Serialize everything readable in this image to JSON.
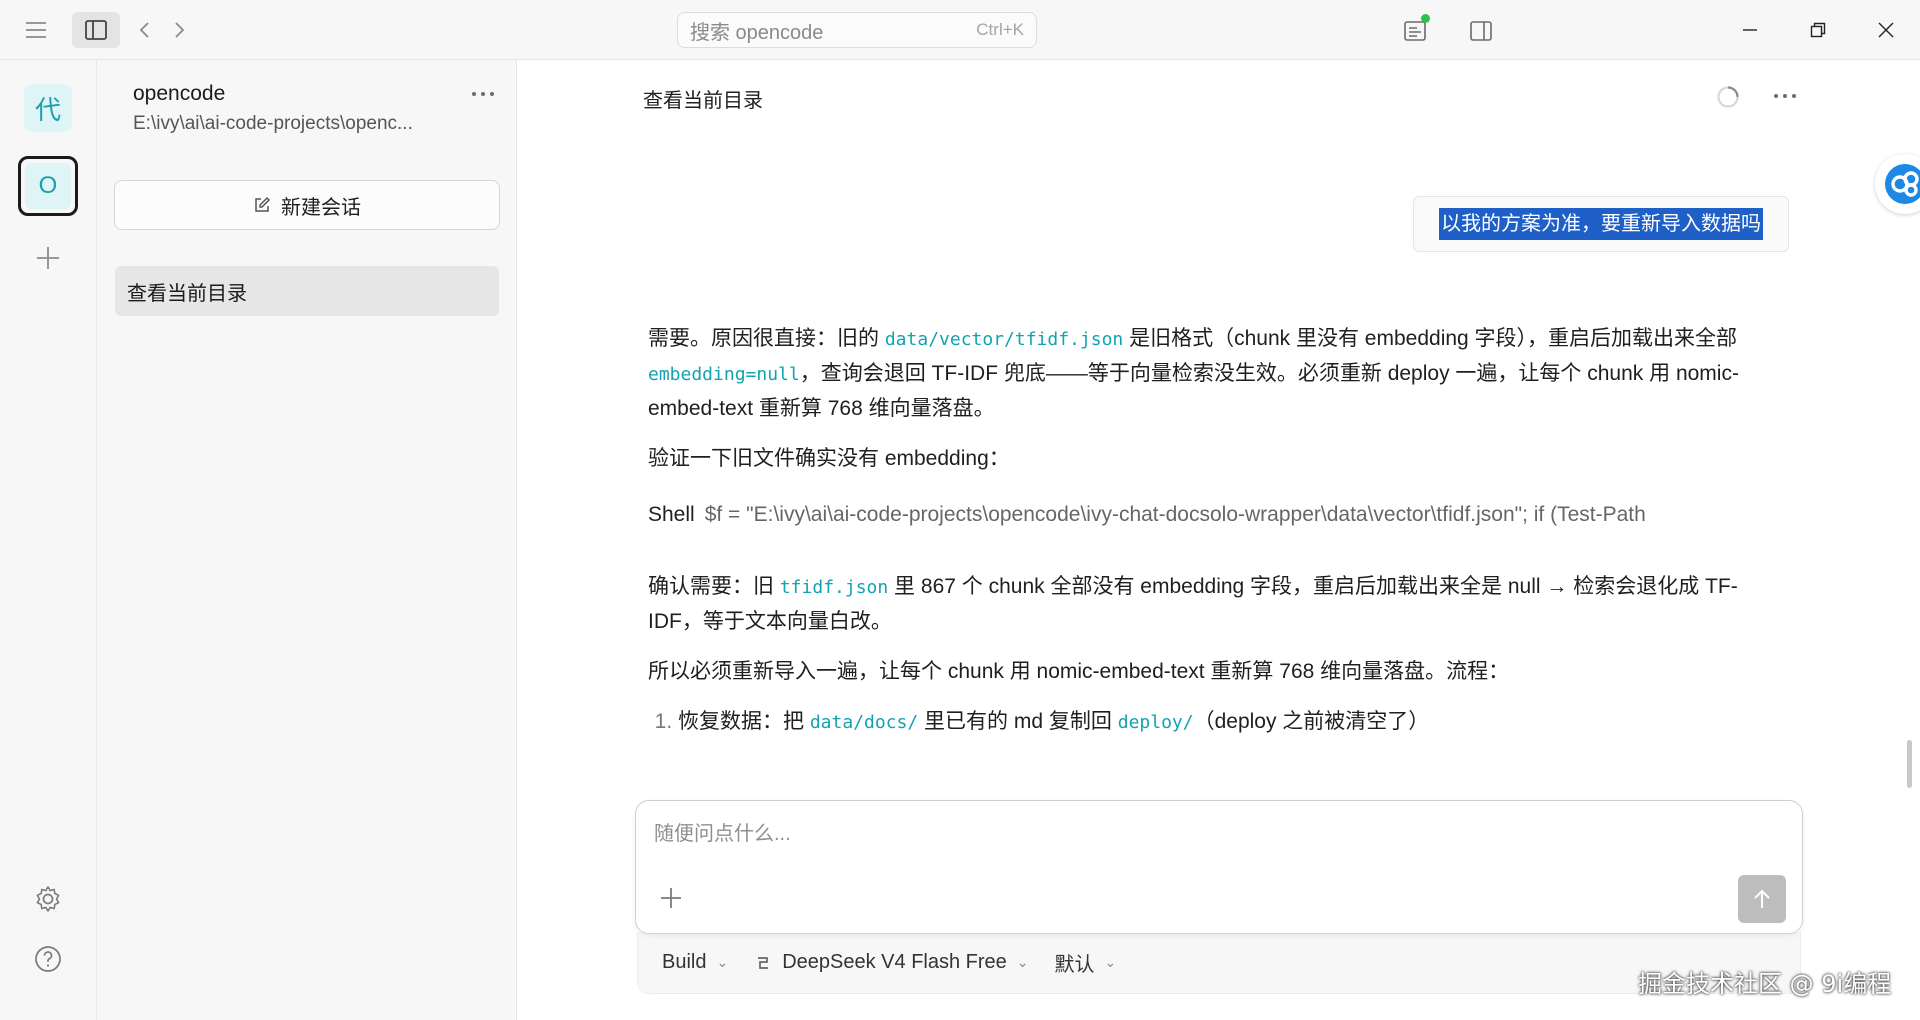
{
  "titlebar": {
    "search_placeholder": "搜索 opencode",
    "search_shortcut": "Ctrl+K",
    "status_dot_color": "#2fbf4c"
  },
  "rail": {
    "projects": [
      {
        "label": "代",
        "active": false
      },
      {
        "label": "O",
        "active": true
      }
    ]
  },
  "sidebar": {
    "project_name": "opencode",
    "project_path": "E:\\ivy\\ai\\ai-code-projects\\openc...",
    "new_session_label": "新建会话",
    "sessions": [
      {
        "title": "查看当前目录",
        "selected": true
      }
    ]
  },
  "main": {
    "session_title": "查看当前目录",
    "user_message": "以我的方案为准，要重新导入数据吗",
    "paragraph1": {
      "t1": "需要。原因很直接：旧的 ",
      "code1": "data/vector/tfidf.json",
      "t2": " 是旧格式（chunk 里没有 embedding 字段），重启后加载出来全部 ",
      "code2": "embedding=null",
      "t3": "，查询会退回 TF-IDF 兜底——等于向量检索没生效。必须重新 deploy 一遍，让每个 chunk 用 nomic-embed-text 重新算 768 维向量落盘。"
    },
    "paragraph2": "验证一下旧文件确实没有 embedding：",
    "shell": {
      "label": "Shell",
      "command": "$f = \"E:\\ivy\\ai\\ai-code-projects\\opencode\\ivy-chat-docsolo-wrapper\\data\\vector\\tfidf.json\"; if (Test-Path"
    },
    "paragraph3": {
      "t1": "确认需要：旧 ",
      "code1": "tfidf.json",
      "t2": " 里 867 个 chunk 全部没有 embedding 字段，重启后加载出来全是 null → 检索会退化成 TF-IDF，等于文本向量白改。"
    },
    "paragraph4": "所以必须重新导入一遍，让每个 chunk 用 nomic-embed-text 重新算 768 维向量落盘。流程：",
    "steps": [
      {
        "t1": "恢复数据：把 ",
        "code1": "data/docs/",
        "t2": " 里已有的 md 复制回 ",
        "code2": "deploy/",
        "t3": "（deploy 之前被清空了）"
      }
    ]
  },
  "composer": {
    "placeholder": "随便问点什么...",
    "agent": "Build",
    "model": "DeepSeek V4 Flash Free",
    "variant": "默认"
  },
  "watermark": "掘金技术社区 @ 9i编程"
}
